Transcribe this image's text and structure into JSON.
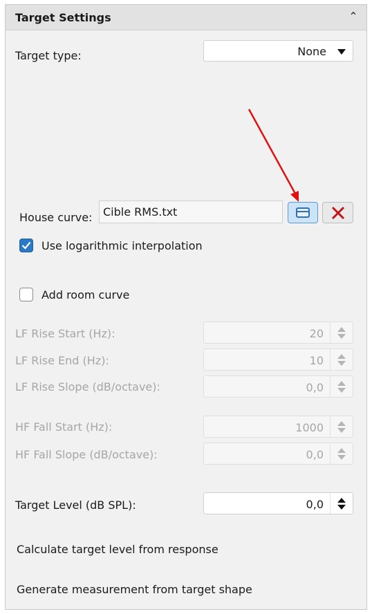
{
  "panel": {
    "title": "Target Settings",
    "collapse_icon": "double-chevron-up-icon"
  },
  "target_type": {
    "label": "Target type:",
    "value": "None"
  },
  "house_curve": {
    "label": "House curve:",
    "value": "Cible RMS.txt",
    "browse_icon": "folder-icon",
    "clear_icon": "close-icon"
  },
  "log_interp": {
    "label": "Use logarithmic interpolation",
    "checked": true
  },
  "room_curve": {
    "label": "Add room curve",
    "checked": false
  },
  "room_fields": [
    {
      "label": "LF Rise Start (Hz):",
      "value": "20"
    },
    {
      "label": "LF Rise End (Hz):",
      "value": "10"
    },
    {
      "label": "LF Rise Slope (dB/octave):",
      "value": "0,0"
    },
    {
      "label": "HF Fall Start (Hz):",
      "value": "1000"
    },
    {
      "label": "HF Fall Slope (dB/octave):",
      "value": "0,0"
    }
  ],
  "target_level": {
    "label": "Target Level (dB SPL):",
    "value": "0,0"
  },
  "actions": {
    "calc_level": "Calculate target level from response",
    "generate": "Generate measurement from target shape"
  },
  "colors": {
    "annotation_arrow": "#e01010",
    "accent": "#2b78c5"
  }
}
